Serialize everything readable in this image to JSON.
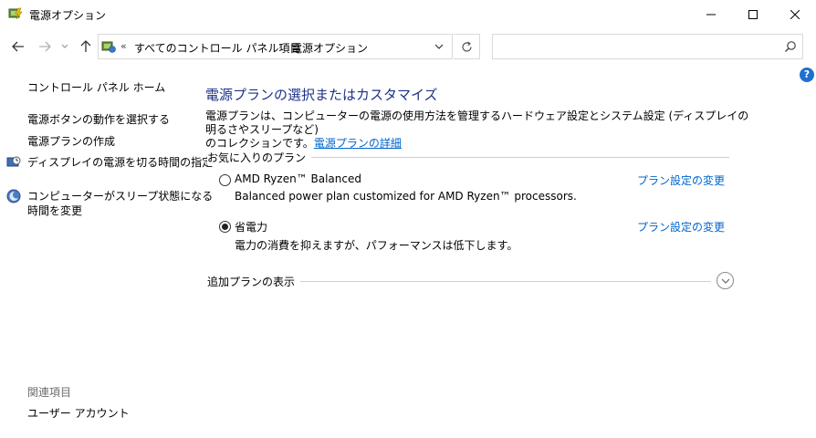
{
  "window": {
    "title": "電源オプション"
  },
  "nav": {
    "recent_arrow": "⌄"
  },
  "address": {
    "separator": "«",
    "crumb1": "すべてのコントロール パネル項目",
    "arrow": "›",
    "crumb2": "電源オプション"
  },
  "search": {
    "placeholder": ""
  },
  "help": {
    "label": "?"
  },
  "sidebar": {
    "home": "コントロール パネル ホーム",
    "links": [
      "電源ボタンの動作を選択する",
      "電源プランの作成",
      "ディスプレイの電源を切る時間の指定",
      "コンピューターがスリープ状態になる",
      "時間を変更"
    ],
    "related_heading": "関連項目",
    "related_link": "ユーザー アカウント"
  },
  "main": {
    "title": "電源プランの選択またはカスタマイズ",
    "desc_line": "電源プランは、コンピューターの電源の使用方法を管理するハードウェア設定とシステム設定 (ディスプレイの明るさやスリープなど)",
    "desc_line2": "のコレクションです。",
    "desc_link": "電源プランの詳細",
    "favorites_label": "お気に入りのプラン",
    "plans": [
      {
        "name": "AMD Ryzen™ Balanced",
        "description": "Balanced power plan customized for AMD Ryzen™ processors.",
        "link": "プラン設定の変更",
        "selected": false
      },
      {
        "name": "省電力",
        "description": "電力の消費を抑えますが、パフォーマンスは低下します。",
        "link": "プラン設定の変更",
        "selected": true
      }
    ],
    "more_plans_label": "追加プランの表示"
  }
}
